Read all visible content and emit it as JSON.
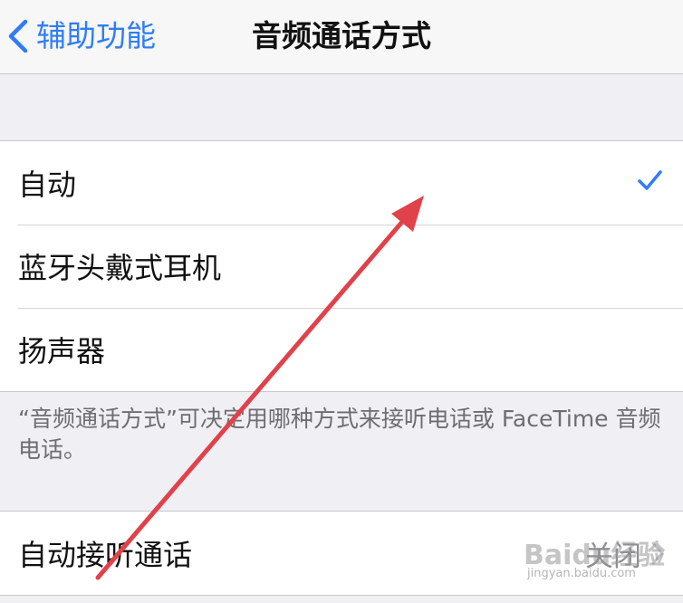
{
  "navbar": {
    "back_label": "辅助功能",
    "title": "音频通话方式"
  },
  "audio_routing": {
    "options": [
      {
        "label": "自动",
        "selected": true
      },
      {
        "label": "蓝牙头戴式耳机",
        "selected": false
      },
      {
        "label": "扬声器",
        "selected": false
      }
    ],
    "footnote": "“音频通话方式”可决定用哪种方式来接听电话或 FaceTime 音频电话。"
  },
  "auto_answer": {
    "label": "自动接听通话",
    "value": "关闭"
  },
  "watermark": {
    "text": "Baidu经验",
    "url": "jingyan.baidu.com"
  },
  "colors": {
    "accent": "#2f7df6",
    "annotation_arrow": "#e0424a",
    "background": "#efeff4"
  },
  "icons": {
    "back": "chevron-left-icon",
    "selected": "checkmark-icon",
    "disclosure": "chevron-right-icon"
  }
}
